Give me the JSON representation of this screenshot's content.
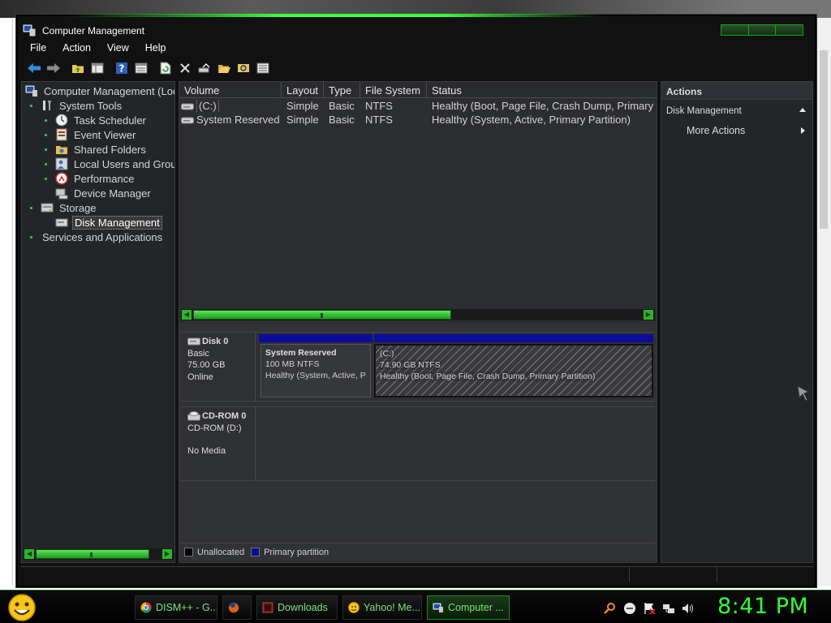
{
  "window": {
    "title": "Computer Management"
  },
  "menu": [
    "File",
    "Action",
    "View",
    "Help"
  ],
  "toolbar_icons": [
    "back-arrow-icon",
    "forward-arrow-icon",
    "up-folder-icon",
    "console-tree-icon",
    "help-icon",
    "properties-icon",
    "refresh-icon",
    "delete-icon",
    "check-disk-icon",
    "open-folder-icon",
    "search-icon",
    "rescan-icon"
  ],
  "tree": {
    "root": "Computer Management (Loc",
    "system_tools": "System Tools",
    "task_scheduler": "Task Scheduler",
    "event_viewer": "Event Viewer",
    "shared_folders": "Shared Folders",
    "local_users": "Local Users and Grou",
    "performance": "Performance",
    "device_manager": "Device Manager",
    "storage": "Storage",
    "disk_management": "Disk Management",
    "services": "Services and Applications"
  },
  "volumes": {
    "columns": [
      "Volume",
      "Layout",
      "Type",
      "File System",
      "Status"
    ],
    "rows": [
      {
        "volume": "(C:)",
        "layout": "Simple",
        "type": "Basic",
        "fs": "NTFS",
        "status": "Healthy (Boot, Page File, Crash Dump, Primary"
      },
      {
        "volume": "System Reserved",
        "layout": "Simple",
        "type": "Basic",
        "fs": "NTFS",
        "status": "Healthy (System, Active, Primary Partition)"
      }
    ]
  },
  "disks": {
    "disk0": {
      "name": "Disk 0",
      "type": "Basic",
      "size": "75.00 GB",
      "state": "Online",
      "partitions": [
        {
          "name": "System Reserved",
          "size": "100 MB NTFS",
          "status": "Healthy (System, Active, P"
        },
        {
          "name": "(C:)",
          "size": "74.90 GB NTFS",
          "status": "Healthy (Boot, Page File, Crash Dump, Primary Partition)"
        }
      ]
    },
    "cdrom0": {
      "name": "CD-ROM 0",
      "type": "CD-ROM (D:)",
      "media": "No Media"
    }
  },
  "legend": {
    "unallocated": "Unallocated",
    "primary": "Primary partition",
    "unallocated_color": "#000000",
    "primary_color": "#0c0c9a"
  },
  "actions": {
    "header": "Actions",
    "section": "Disk Management",
    "more": "More Actions"
  },
  "taskbar": {
    "items": [
      {
        "label": "DISM++ - G...",
        "icon": "chrome-icon"
      },
      {
        "label": "",
        "icon": "firefox-icon"
      },
      {
        "label": "Downloads",
        "icon": "downloads-icon"
      },
      {
        "label": "Yahoo! Me...",
        "icon": "yahoo-messenger-icon"
      },
      {
        "label": "Computer ...",
        "icon": "computer-management-icon"
      }
    ],
    "clock": "8:41 PM"
  },
  "colors": {
    "accent_green": "#33ff33",
    "primary_partition_blue": "#0c0c9a"
  }
}
